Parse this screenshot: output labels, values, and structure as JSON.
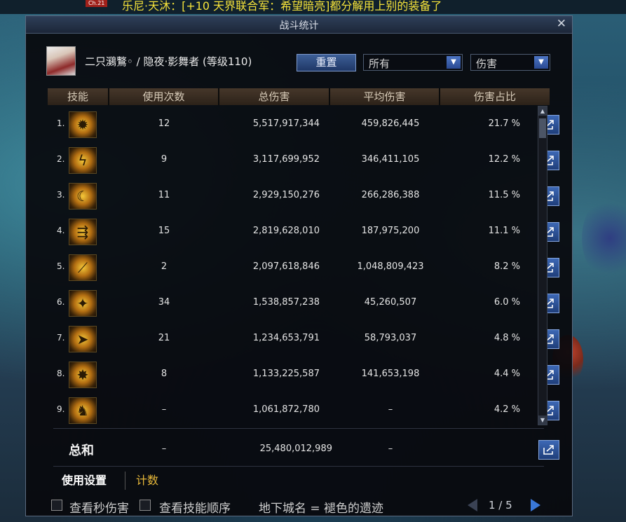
{
  "chat": {
    "badge": "Ch.21",
    "message": "乐尼·天沐：[+10 天界联合军：希望暗亮]都分解用上别的装备了"
  },
  "window": {
    "title": "战斗统计",
    "close": "✕"
  },
  "character": {
    "name_line": "二只鸂鷘◦ / 隐夜·影舞者 (等级110)"
  },
  "controls": {
    "reset_label": "重置",
    "filter_value": "所有",
    "metric_value": "伤害",
    "arrow": "▼"
  },
  "table": {
    "headers": [
      "技能",
      "使用次数",
      "总伤害",
      "平均伤害",
      "伤害占比"
    ],
    "rows": [
      {
        "rank": "1.",
        "icon": "burst-skill-icon",
        "uses": "12",
        "total": "5,517,917,344",
        "avg": "459,826,445",
        "pct": "21.7 %"
      },
      {
        "rank": "2.",
        "icon": "shadow-strike-skill-icon",
        "uses": "9",
        "total": "3,117,699,952",
        "avg": "346,411,105",
        "pct": "12.2 %"
      },
      {
        "rank": "3.",
        "icon": "blade-face-skill-icon",
        "uses": "11",
        "total": "2,929,150,276",
        "avg": "266,286,388",
        "pct": "11.5 %"
      },
      {
        "rank": "4.",
        "icon": "dagger-line-skill-icon",
        "uses": "15",
        "total": "2,819,628,010",
        "avg": "187,975,200",
        "pct": "11.1 %"
      },
      {
        "rank": "5.",
        "icon": "slash-skill-icon",
        "uses": "2",
        "total": "2,097,618,846",
        "avg": "1,048,809,423",
        "pct": "8.2 %"
      },
      {
        "rank": "6.",
        "icon": "dash-skill-icon",
        "uses": "34",
        "total": "1,538,857,238",
        "avg": "45,260,507",
        "pct": "6.0 %"
      },
      {
        "rank": "7.",
        "icon": "arrow-rush-skill-icon",
        "uses": "21",
        "total": "1,234,653,791",
        "avg": "58,793,037",
        "pct": "4.8 %"
      },
      {
        "rank": "8.",
        "icon": "star-burst-skill-icon",
        "uses": "8",
        "total": "1,133,225,587",
        "avg": "141,653,198",
        "pct": "4.4 %"
      },
      {
        "rank": "9.",
        "icon": "kneel-skill-icon",
        "uses": "–",
        "total": "1,061,872,780",
        "avg": "–",
        "pct": "4.2 %"
      }
    ],
    "total": {
      "label": "总和",
      "uses": "–",
      "total": "25,480,012,989",
      "avg": "–"
    }
  },
  "scroll": {
    "up": "▲",
    "down": "▼"
  },
  "tabs": [
    {
      "label": "使用设置",
      "active": true
    },
    {
      "label": "计数",
      "active": false
    }
  ],
  "footer": {
    "check_per_second": "查看秒伤害",
    "check_skill_order": "查看技能顺序",
    "dungeon": "地下城名 = 褪色的遗迹",
    "page": "1 / 5"
  },
  "colors": {
    "accent_blue": "#3d68b5",
    "header_gold": "#d6cab7",
    "tab_active": "#ffffff",
    "tab_inactive": "#e8b93a",
    "chat_yellow": "#f4e23a"
  }
}
